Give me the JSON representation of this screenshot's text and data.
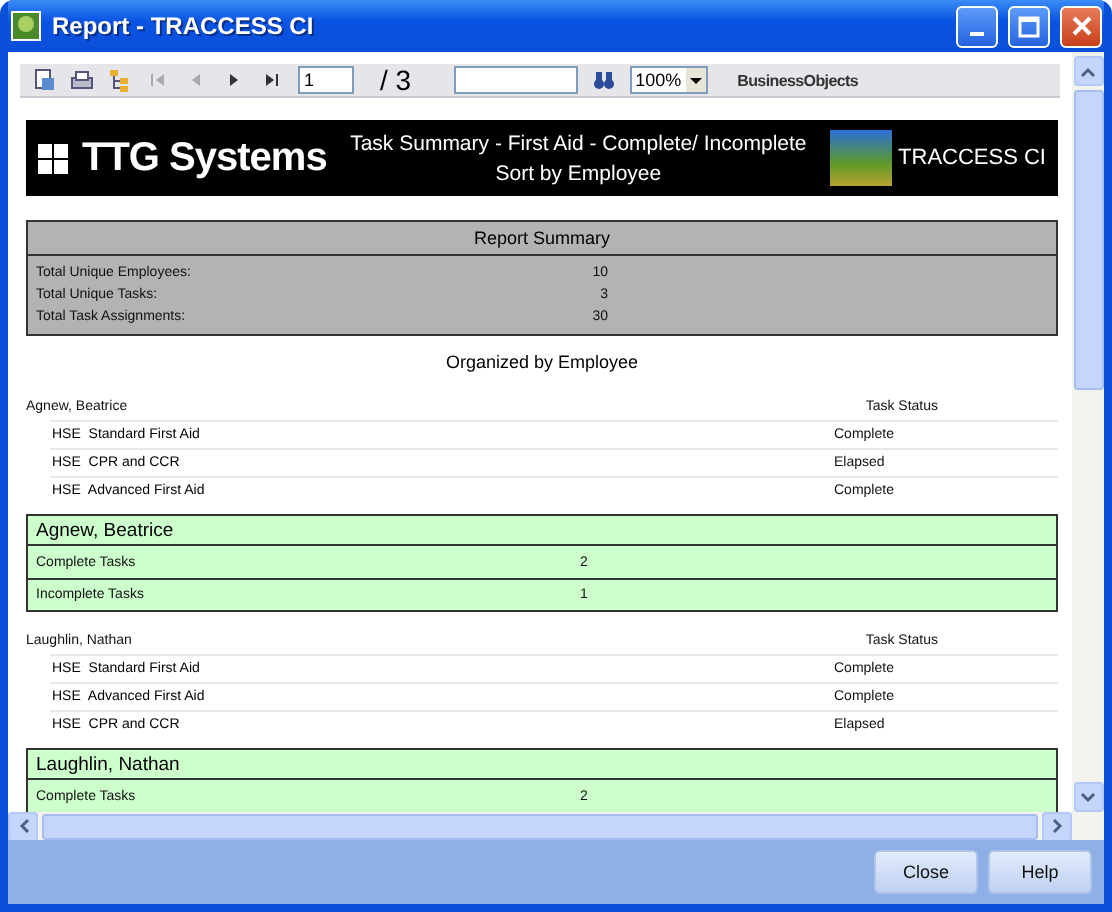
{
  "window": {
    "title": "Report - TRACCESS CI"
  },
  "toolbar": {
    "page_field": "1",
    "page_total": "/ 3",
    "zoom": "100%",
    "brand": "BusinessObjects"
  },
  "banner": {
    "company": "TTG Systems",
    "title": "Task Summary - First Aid - Complete/ Incomplete",
    "subtitle": "Sort by Employee",
    "product": "TRACCESS CI"
  },
  "summary": {
    "title": "Report Summary",
    "rows": [
      {
        "label": "Total Unique Employees:",
        "value": "10"
      },
      {
        "label": "Total Unique Tasks:",
        "value": "3"
      },
      {
        "label": "Total Task Assignments:",
        "value": "30"
      }
    ]
  },
  "section_title": "Organized by Employee",
  "employees": [
    {
      "name": "Agnew, Beatrice",
      "status_heading": "Task Status",
      "tasks": [
        {
          "code": "HSE",
          "name": "Standard First Aid",
          "status": "Complete"
        },
        {
          "code": "HSE",
          "name": "CPR and CCR",
          "status": "Elapsed"
        },
        {
          "code": "HSE",
          "name": "Advanced First Aid",
          "status": "Complete"
        }
      ],
      "totals": {
        "name": "Agnew, Beatrice",
        "rows": [
          {
            "label": "Complete Tasks",
            "value": "2"
          },
          {
            "label": "Incomplete Tasks",
            "value": "1"
          }
        ]
      }
    },
    {
      "name": "Laughlin, Nathan",
      "status_heading": "Task Status",
      "tasks": [
        {
          "code": "HSE",
          "name": "Standard First Aid",
          "status": "Complete"
        },
        {
          "code": "HSE",
          "name": "Advanced First Aid",
          "status": "Complete"
        },
        {
          "code": "HSE",
          "name": "CPR and CCR",
          "status": "Elapsed"
        }
      ],
      "totals": {
        "name": "Laughlin, Nathan",
        "rows": [
          {
            "label": "Complete Tasks",
            "value": "2"
          }
        ]
      }
    }
  ],
  "buttons": [
    "Close",
    "Help"
  ]
}
